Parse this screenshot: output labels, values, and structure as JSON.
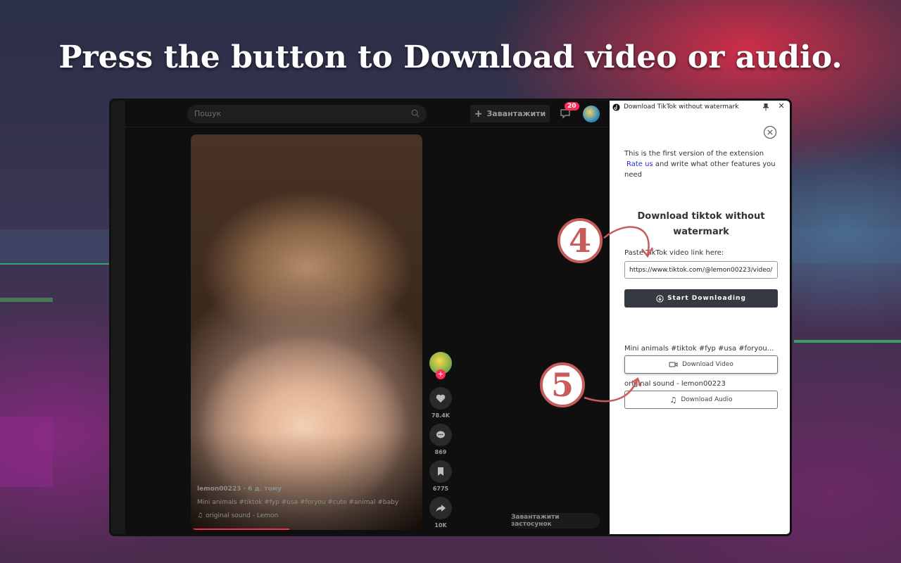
{
  "headline": "Press the button to Download video or audio.",
  "tiktok": {
    "search_placeholder": "Пошук",
    "upload_label": "Завантажити",
    "inbox_badge": "20",
    "video": {
      "author_line": "lemon00223 · 6 д. тому",
      "caption": "Mini animals #tiktok  #fyp  #usa  #foryou  #cute  #animal  #baby",
      "sound": "original sound - Lemon"
    },
    "actions": {
      "likes": "78.4K",
      "comments": "869",
      "saves": "6775",
      "shares": "10K"
    },
    "get_app_label": "Завантажити застосунок"
  },
  "extension": {
    "title": "Download TikTok without watermark",
    "intro_text": "This is the first version of the extension",
    "rate_link": "Rate us",
    "intro_text_2": "and write what other features you need",
    "heading": "Download tiktok without watermark",
    "paste_label": "Paste TikTok video link here:",
    "url_value": "https://www.tiktok.com/@lemon00223/video/",
    "start_button": "Start Downloading",
    "video_title": "Mini animals #tiktok #fyp #usa #foryou...",
    "download_video_button": "Download Video",
    "sound_title": "original sound - lemon00223",
    "download_audio_button": "Download Audio"
  },
  "callouts": {
    "step_paste": "4",
    "step_download": "5"
  },
  "colors": {
    "accent_red": "#fe2c55",
    "callout": "#c85b5b",
    "dark_button": "#343a40",
    "link": "#2a2ad0"
  }
}
